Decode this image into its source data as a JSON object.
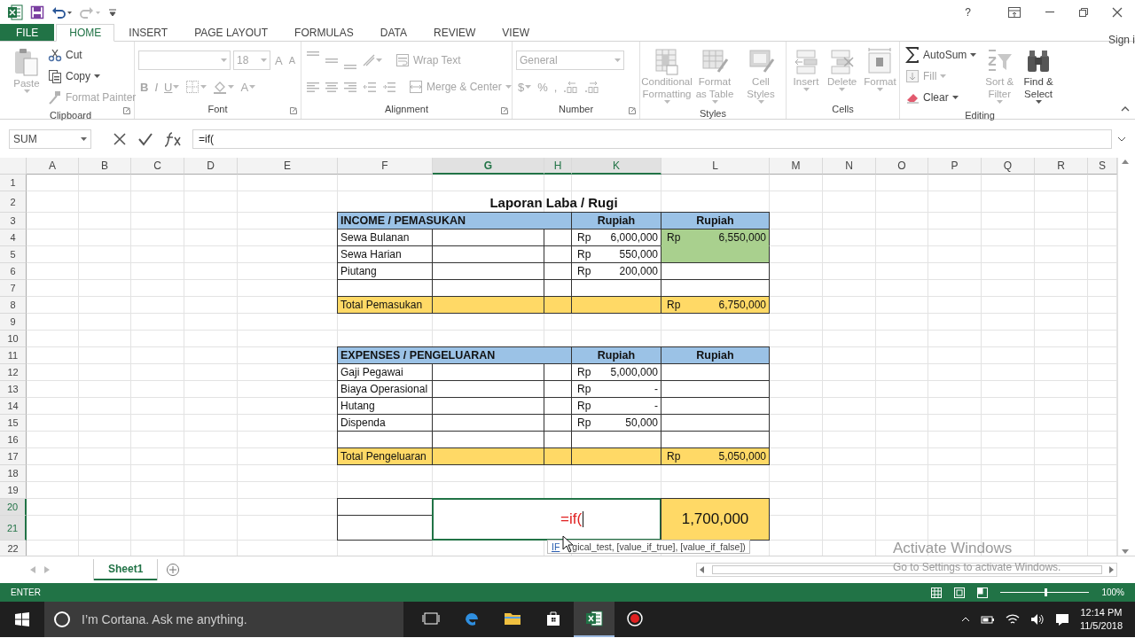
{
  "title_bar": {
    "help": "?"
  },
  "tabs": [
    {
      "label": "FILE",
      "kind": "file",
      "selected": false
    },
    {
      "label": "HOME",
      "kind": "tab",
      "selected": true
    },
    {
      "label": "INSERT",
      "kind": "tab",
      "selected": false
    },
    {
      "label": "PAGE LAYOUT",
      "kind": "tab",
      "selected": false
    },
    {
      "label": "FORMULAS",
      "kind": "tab",
      "selected": false
    },
    {
      "label": "DATA",
      "kind": "tab",
      "selected": false
    },
    {
      "label": "REVIEW",
      "kind": "tab",
      "selected": false
    },
    {
      "label": "VIEW",
      "kind": "tab",
      "selected": false
    }
  ],
  "account": "Sign i",
  "ribbon": {
    "groups": [
      {
        "label": "Clipboard",
        "launcher": true,
        "items": [
          {
            "kind": "large",
            "label": "Paste",
            "disabled": true,
            "dropdown": true
          },
          {
            "kind": "stack",
            "items": [
              {
                "label": "Cut",
                "disabled": false,
                "dropdown": false
              },
              {
                "label": "Copy",
                "disabled": false,
                "dropdown": true
              },
              {
                "label": "Format Painter",
                "disabled": true,
                "dropdown": false
              }
            ]
          }
        ]
      },
      {
        "label": "Font",
        "launcher": true,
        "items": [
          {
            "kind": "two_line",
            "upper": [
              {
                "kind": "field",
                "disabled": true
              },
              {
                "kind": "field",
                "value": "18",
                "disabled": true
              },
              {
                "kind": "glyph",
                "text": "A",
                "disabled": true,
                "dropdown": false
              },
              {
                "kind": "glyph",
                "text": "A",
                "disabled": true,
                "dropdown": false
              }
            ],
            "lower": [
              {
                "kind": "glyph",
                "text": "B",
                "disabled": true,
                "dropdown": false
              },
              {
                "kind": "glyph",
                "text": "I",
                "disabled": true,
                "dropdown": false
              },
              {
                "kind": "glyph",
                "text": "U",
                "disabled": true,
                "dropdown": true
              },
              {
                "kind": "icon",
                "disabled": true,
                "dropdown": true
              },
              {
                "kind": "icon",
                "disabled": true,
                "dropdown": true
              },
              {
                "kind": "glyph",
                "text": "A",
                "disabled": true,
                "dropdown": true
              }
            ]
          }
        ]
      },
      {
        "label": "Alignment",
        "launcher": true,
        "items": [
          {
            "kind": "two_line",
            "upper": [
              {
                "kind": "icon",
                "disabled": true,
                "dropdown": false
              },
              {
                "kind": "icon",
                "disabled": true,
                "dropdown": false
              },
              {
                "kind": "icon",
                "disabled": true,
                "dropdown": false
              },
              {
                "kind": "icon",
                "disabled": true,
                "dropdown": true
              },
              {
                "kind": "small",
                "label": "Wrap Text",
                "disabled": true,
                "dropdown": false
              }
            ],
            "lower": [
              {
                "kind": "icon",
                "disabled": true,
                "dropdown": false
              },
              {
                "kind": "icon",
                "disabled": true,
                "dropdown": false
              },
              {
                "kind": "icon",
                "disabled": true,
                "dropdown": false
              },
              {
                "kind": "icon",
                "disabled": true,
                "dropdown": false
              },
              {
                "kind": "icon",
                "disabled": true,
                "dropdown": false
              },
              {
                "kind": "small",
                "label": "Merge & Center",
                "disabled": true,
                "dropdown": true
              }
            ]
          }
        ]
      },
      {
        "label": "Number",
        "launcher": true,
        "items": [
          {
            "kind": "two_line",
            "upper": [
              {
                "kind": "field",
                "value": "General",
                "disabled": true
              }
            ],
            "lower": [
              {
                "kind": "glyph",
                "text": "$",
                "disabled": true,
                "dropdown": true
              },
              {
                "kind": "glyph",
                "text": "%",
                "disabled": true,
                "dropdown": false
              },
              {
                "kind": "glyph",
                "text": ",",
                "disabled": true,
                "dropdown": false
              },
              {
                "kind": "icon",
                "disabled": true,
                "dropdown": false
              },
              {
                "kind": "icon",
                "disabled": true,
                "dropdown": false
              }
            ]
          }
        ]
      },
      {
        "label": "Styles",
        "launcher": false,
        "items": [
          {
            "kind": "large",
            "label": "Conditional Formatting",
            "disabled": true,
            "dropdown": true
          },
          {
            "kind": "large",
            "label": "Format as Table",
            "disabled": true,
            "dropdown": true
          },
          {
            "kind": "large",
            "label": "Cell Styles",
            "disabled": true,
            "dropdown": true
          }
        ]
      },
      {
        "label": "Cells",
        "launcher": false,
        "items": [
          {
            "kind": "large",
            "label": "Insert",
            "disabled": true,
            "dropdown": true
          },
          {
            "kind": "large",
            "label": "Delete",
            "disabled": true,
            "dropdown": true
          },
          {
            "kind": "large",
            "label": "Format",
            "disabled": true,
            "dropdown": true
          }
        ]
      },
      {
        "label": "Editing",
        "launcher": false,
        "items": [
          {
            "kind": "stack",
            "items": [
              {
                "label": "AutoSum",
                "disabled": false,
                "dropdown": true
              },
              {
                "label": "Fill",
                "disabled": true,
                "dropdown": true
              },
              {
                "label": "Clear",
                "disabled": false,
                "dropdown": true
              }
            ]
          },
          {
            "kind": "large",
            "label": "Sort & Filter",
            "disabled": true,
            "dropdown": true
          },
          {
            "kind": "large",
            "label": "Find & Select",
            "disabled": false,
            "dropdown": true
          }
        ]
      }
    ]
  },
  "formula_bar": {
    "name_box": "SUM",
    "formula": "=if("
  },
  "sheet": {
    "columns": [
      {
        "label": "A",
        "selected": false
      },
      {
        "label": "B",
        "selected": false
      },
      {
        "label": "C",
        "selected": false
      },
      {
        "label": "D",
        "selected": false
      },
      {
        "label": "E",
        "selected": false
      },
      {
        "label": "F",
        "selected": false
      },
      {
        "label": "G",
        "selected": true
      },
      {
        "label": "H",
        "selected": true
      },
      {
        "label": "K",
        "selected": true
      },
      {
        "label": "L",
        "selected": false
      },
      {
        "label": "M",
        "selected": false
      },
      {
        "label": "N",
        "selected": false
      },
      {
        "label": "O",
        "selected": false
      },
      {
        "label": "P",
        "selected": false
      },
      {
        "label": "Q",
        "selected": false
      },
      {
        "label": "R",
        "selected": false
      },
      {
        "label": "S",
        "selected": false
      }
    ],
    "rows": [
      {
        "label": "1",
        "selected": false
      },
      {
        "label": "2",
        "selected": false
      },
      {
        "label": "3",
        "selected": false
      },
      {
        "label": "4",
        "selected": false
      },
      {
        "label": "5",
        "selected": false
      },
      {
        "label": "6",
        "selected": false
      },
      {
        "label": "7",
        "selected": false
      },
      {
        "label": "8",
        "selected": false
      },
      {
        "label": "9",
        "selected": false
      },
      {
        "label": "10",
        "selected": false
      },
      {
        "label": "11",
        "selected": false
      },
      {
        "label": "12",
        "selected": false
      },
      {
        "label": "13",
        "selected": false
      },
      {
        "label": "14",
        "selected": false
      },
      {
        "label": "15",
        "selected": false
      },
      {
        "label": "16",
        "selected": false
      },
      {
        "label": "17",
        "selected": false
      },
      {
        "label": "18",
        "selected": false
      },
      {
        "label": "19",
        "selected": false
      },
      {
        "label": "20",
        "selected": true
      },
      {
        "label": "21",
        "selected": true
      },
      {
        "label": "22",
        "selected": false
      }
    ]
  },
  "report": {
    "title": "Laporan Laba / Rugi",
    "sections": [
      {
        "heading": "INCOME / PEMASUKAN",
        "currency_headers": [
          "Rupiah",
          "Rupiah"
        ],
        "items": [
          {
            "label": "Sewa Bulanan",
            "amount": {
              "prefix": "Rp",
              "value": "6,000,000"
            },
            "column_l": {
              "highlighted": true,
              "prefix": "Rp",
              "value": "6,550,000"
            }
          },
          {
            "label": "Sewa Harian",
            "amount": {
              "prefix": "Rp",
              "value": "550,000"
            },
            "column_l": {
              "highlighted": true
            }
          },
          {
            "label": "Piutang",
            "amount": {
              "prefix": "Rp",
              "value": "200,000"
            }
          }
        ],
        "total": {
          "label": "Total Pemasukan",
          "prefix": "Rp",
          "value": "6,750,000"
        }
      },
      {
        "heading": "EXPENSES / PENGELUARAN",
        "currency_headers": [
          "Rupiah",
          "Rupiah"
        ],
        "items": [
          {
            "label": "Gaji Pegawai",
            "amount": {
              "prefix": "Rp",
              "value": "5,000,000"
            }
          },
          {
            "label": "Biaya Operasional",
            "amount": {
              "prefix": "Rp",
              "value": "-"
            }
          },
          {
            "label": "Hutang",
            "amount": {
              "prefix": "Rp",
              "value": "-"
            }
          },
          {
            "label": "Dispenda",
            "amount": {
              "prefix": "Rp",
              "value": "50,000"
            }
          }
        ],
        "total": {
          "label": "Total Pengeluaran",
          "prefix": "Rp",
          "value": "5,050,000"
        }
      }
    ],
    "result": {
      "editing_value": "=if(",
      "value": "1,700,000"
    }
  },
  "tooltip": {
    "function": "IF",
    "arguments": "gical_test, [value_if_true], [value_if_false])"
  },
  "sheet_tabs": [
    {
      "label": "Sheet1",
      "selected": true
    }
  ],
  "status_bar": {
    "mode": "ENTER",
    "zoom_slider": {
      "level": 0.5
    },
    "zoom": "100%"
  },
  "activation_notice": {
    "title": "Activate Windows",
    "message": "Go to Settings to activate Windows."
  },
  "taskbar": {
    "search": {
      "placeholder": "I’m Cortana. Ask me anything."
    },
    "apps": [
      {
        "selected": false
      },
      {
        "selected": false
      },
      {
        "selected": false
      },
      {
        "selected": false
      },
      {
        "selected": true
      },
      {
        "selected": false
      }
    ],
    "time": "12:14 PM",
    "date": "11/5/2018"
  }
}
